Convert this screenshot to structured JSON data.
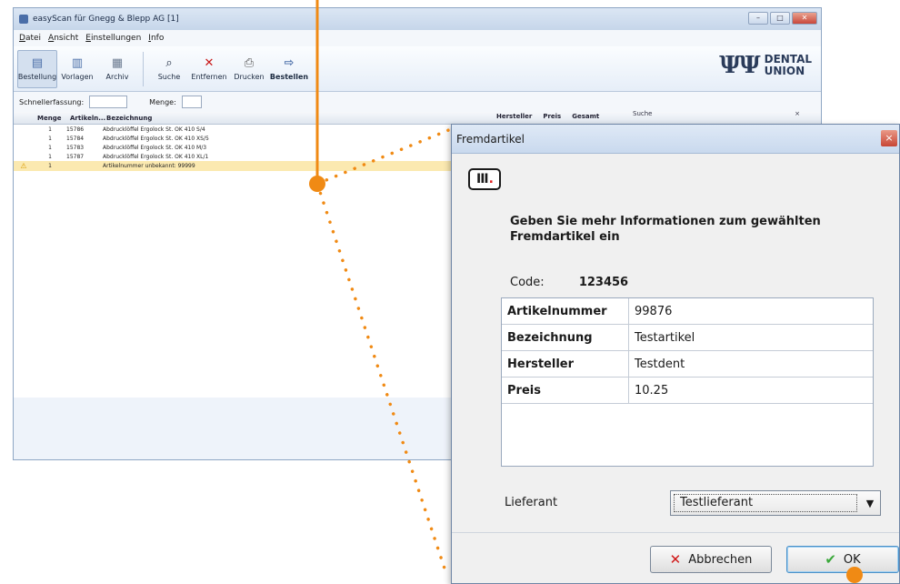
{
  "main_window": {
    "title": "easyScan für Gnegg & Blepp AG [1]",
    "menu": [
      "Datei",
      "Ansicht",
      "Einstellungen",
      "Info"
    ],
    "toolbar": {
      "bestellung": "Bestellung",
      "vorlagen": "Vorlagen",
      "archiv": "Archiv",
      "suche": "Suche",
      "entfernen": "Entfernen",
      "drucken": "Drucken",
      "bestellen": "Bestellen"
    },
    "logo_text_1": "DENTAL",
    "logo_text_2": "UNION",
    "quick_entry": {
      "schnellerfassung_label": "Schnellerfassung:",
      "menge_label": "Menge:"
    },
    "grid": {
      "headers": [
        "Menge",
        "Artikeln...",
        "Bezeichnung"
      ],
      "extra_headers": [
        "Hersteller",
        "Preis",
        "Gesamt"
      ],
      "search_tab": "Suche",
      "search_close": "×",
      "rows": [
        {
          "qty": "1",
          "article": "15786",
          "description": "Abdrucklöffel Ergolock St. OK 410 S/4"
        },
        {
          "qty": "1",
          "article": "15784",
          "description": "Abdrucklöffel Ergolock St. OK 410 XS/5"
        },
        {
          "qty": "1",
          "article": "15783",
          "description": "Abdrucklöffel Ergolock St. OK 410 M/3"
        },
        {
          "qty": "1",
          "article": "15787",
          "description": "Abdrucklöffel Ergolock St. OK 410 XL/1"
        }
      ],
      "warning_row": {
        "qty": "1",
        "description": "Artikelnummer unbekannt: 99999"
      }
    }
  },
  "dialog": {
    "title": "Fremdartikel",
    "close": "×",
    "logo": "III",
    "heading": "Geben Sie mehr Informationen zum gewählten Fremdartikel ein",
    "code_label": "Code:",
    "code_value": "123456",
    "fields": [
      {
        "key": "Artikelnummer",
        "value": "99876"
      },
      {
        "key": "Bezeichnung",
        "value": "Testartikel"
      },
      {
        "key": "Hersteller",
        "value": "Testdent"
      },
      {
        "key": "Preis",
        "value": "10.25"
      }
    ],
    "supplier_label": "Lieferant",
    "supplier_value": "Testlieferant",
    "cancel_label": "Abbrechen",
    "ok_label": "OK"
  },
  "colors": {
    "annotation": "#f08a14",
    "warning_row": "#fbe9b0"
  }
}
